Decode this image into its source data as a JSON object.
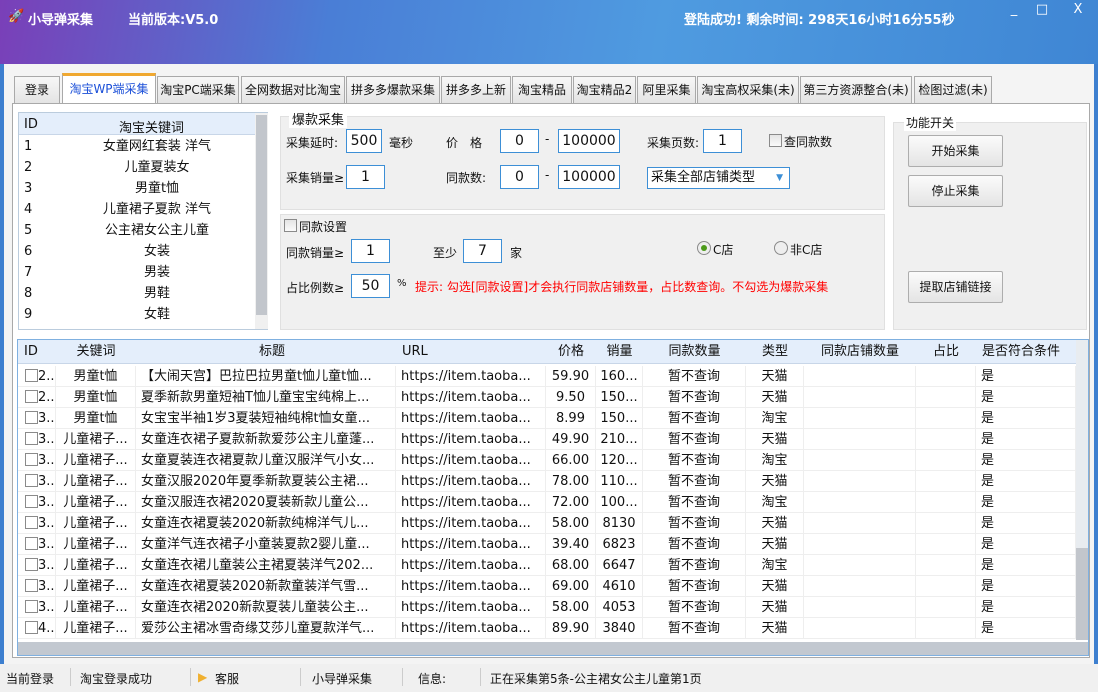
{
  "app": {
    "name": "小导弹采集",
    "version": "当前版本:V5.0",
    "login_status": "登陆成功! 剩余时间: 298天16小时16分55秒"
  },
  "window_controls": [
    "_",
    "□",
    "X"
  ],
  "tabs": [
    {
      "label": "登录"
    },
    {
      "label": "淘宝WP端采集",
      "active": true
    },
    {
      "label": "淘宝PC端采集"
    },
    {
      "label": "全网数据对比淘宝"
    },
    {
      "label": "拼多多爆款采集"
    },
    {
      "label": "拼多多上新"
    },
    {
      "label": "淘宝精品"
    },
    {
      "label": "淘宝精品2"
    },
    {
      "label": "阿里采集"
    },
    {
      "label": "淘宝高权采集(未)"
    },
    {
      "label": "第三方资源整合(未)"
    },
    {
      "label": "检图过滤(未)"
    }
  ],
  "keywords": {
    "headers": [
      "ID",
      "淘宝关键词"
    ],
    "rows": [
      [
        "1",
        "女童网红套装 洋气"
      ],
      [
        "2",
        "儿童夏装女"
      ],
      [
        "3",
        "男童t恤"
      ],
      [
        "4",
        "儿童裙子夏款 洋气"
      ],
      [
        "5",
        "公主裙女公主儿童"
      ],
      [
        "6",
        "女装"
      ],
      [
        "7",
        "男装"
      ],
      [
        "8",
        "男鞋"
      ],
      [
        "9",
        "女鞋"
      ]
    ]
  },
  "explosive": {
    "title": "爆款采集",
    "delay_label": "采集延时:",
    "delay": "500",
    "delay_unit": "毫秒",
    "price_label": "价　格",
    "price_min": "0",
    "price_max": "100000",
    "dash": "-",
    "pages_label": "采集页数:",
    "pages": "1",
    "check_same_label": "查同款数",
    "sales_label": "采集销量≥",
    "sales": "1",
    "same_label": "同款数:",
    "same_min": "0",
    "same_max": "100000",
    "shop_type": "采集全部店铺类型"
  },
  "same_settings": {
    "checkbox_label": "同款设置",
    "same_sales_label": "同款销量≥",
    "same_sales": "1",
    "at_least_label": "至少",
    "at_least": "7",
    "shops_unit": "家",
    "radio_c": "C店",
    "radio_non_c": "非C店",
    "selected": "C店",
    "ratio_label": "占比例数≥",
    "ratio": "50",
    "percent": "%",
    "hint": "提示: 勾选[同款设置]才会执行同款店铺数量，占比数查询。不勾选为爆款采集",
    "hint_color": "#ff0000"
  },
  "functions": {
    "title": "功能开关",
    "start": "开始采集",
    "stop": "停止采集",
    "extract": "提取店铺链接"
  },
  "results": {
    "headers": [
      "ID",
      "关键词",
      "标题",
      "URL",
      "价格",
      "销量",
      "同款数量",
      "类型",
      "同款店铺数量",
      "占比",
      "是否符合条件"
    ],
    "rows": [
      [
        "2..",
        "男童t恤",
        "【大闹天宫】巴拉巴拉男童t恤儿童t恤...",
        "https://item.taoba...",
        "59.90",
        "160...",
        "暂不查询",
        "天猫",
        "",
        "",
        "是"
      ],
      [
        "2..",
        "男童t恤",
        "夏季新款男童短袖T恤儿童宝宝纯棉上...",
        "https://item.taoba...",
        "9.50",
        "150...",
        "暂不查询",
        "天猫",
        "",
        "",
        "是"
      ],
      [
        "3..",
        "男童t恤",
        "女宝宝半袖1岁3夏装短袖纯棉t恤女童...",
        "https://item.taoba...",
        "8.99",
        "150...",
        "暂不查询",
        "淘宝",
        "",
        "",
        "是"
      ],
      [
        "3..",
        "儿童裙子...",
        "女童连衣裙子夏款新款爱莎公主儿童蓬...",
        "https://item.taoba...",
        "49.90",
        "210...",
        "暂不查询",
        "天猫",
        "",
        "",
        "是"
      ],
      [
        "3..",
        "儿童裙子...",
        "女童夏装连衣裙夏款儿童汉服洋气小女...",
        "https://item.taoba...",
        "66.00",
        "120...",
        "暂不查询",
        "淘宝",
        "",
        "",
        "是"
      ],
      [
        "3..",
        "儿童裙子...",
        "女童汉服2020年夏季新款夏装公主裙...",
        "https://item.taoba...",
        "78.00",
        "110...",
        "暂不查询",
        "天猫",
        "",
        "",
        "是"
      ],
      [
        "3..",
        "儿童裙子...",
        "女童汉服连衣裙2020夏装新款儿童公...",
        "https://item.taoba...",
        "72.00",
        "100...",
        "暂不查询",
        "淘宝",
        "",
        "",
        "是"
      ],
      [
        "3..",
        "儿童裙子...",
        "女童连衣裙夏装2020新款纯棉洋气儿...",
        "https://item.taoba...",
        "58.00",
        "8130",
        "暂不查询",
        "天猫",
        "",
        "",
        "是"
      ],
      [
        "3..",
        "儿童裙子...",
        "女童洋气连衣裙子小童装夏款2婴儿童...",
        "https://item.taoba...",
        "39.40",
        "6823",
        "暂不查询",
        "天猫",
        "",
        "",
        "是"
      ],
      [
        "3..",
        "儿童裙子...",
        "女童连衣裙儿童装公主裙夏装洋气202...",
        "https://item.taoba...",
        "68.00",
        "6647",
        "暂不查询",
        "淘宝",
        "",
        "",
        "是"
      ],
      [
        "3..",
        "儿童裙子...",
        "女童连衣裙夏装2020新款童装洋气雪...",
        "https://item.taoba...",
        "69.00",
        "4610",
        "暂不查询",
        "天猫",
        "",
        "",
        "是"
      ],
      [
        "3..",
        "儿童裙子...",
        "女童连衣裙2020新款夏装儿童装公主...",
        "https://item.taoba...",
        "58.00",
        "4053",
        "暂不查询",
        "天猫",
        "",
        "",
        "是"
      ],
      [
        "4..",
        "儿童裙子...",
        "爱莎公主裙冰雪奇缘艾莎儿童夏款洋气...",
        "https://item.taoba...",
        "89.90",
        "3840",
        "暂不查询",
        "天猫",
        "",
        "",
        "是"
      ]
    ]
  },
  "status": {
    "current_login": "当前登录",
    "login_result": "淘宝登录成功",
    "service": "客服",
    "app_name": "小导弹采集",
    "info_label": "信息:",
    "info": "正在采集第5条-公主裙女公主儿童第1页"
  }
}
